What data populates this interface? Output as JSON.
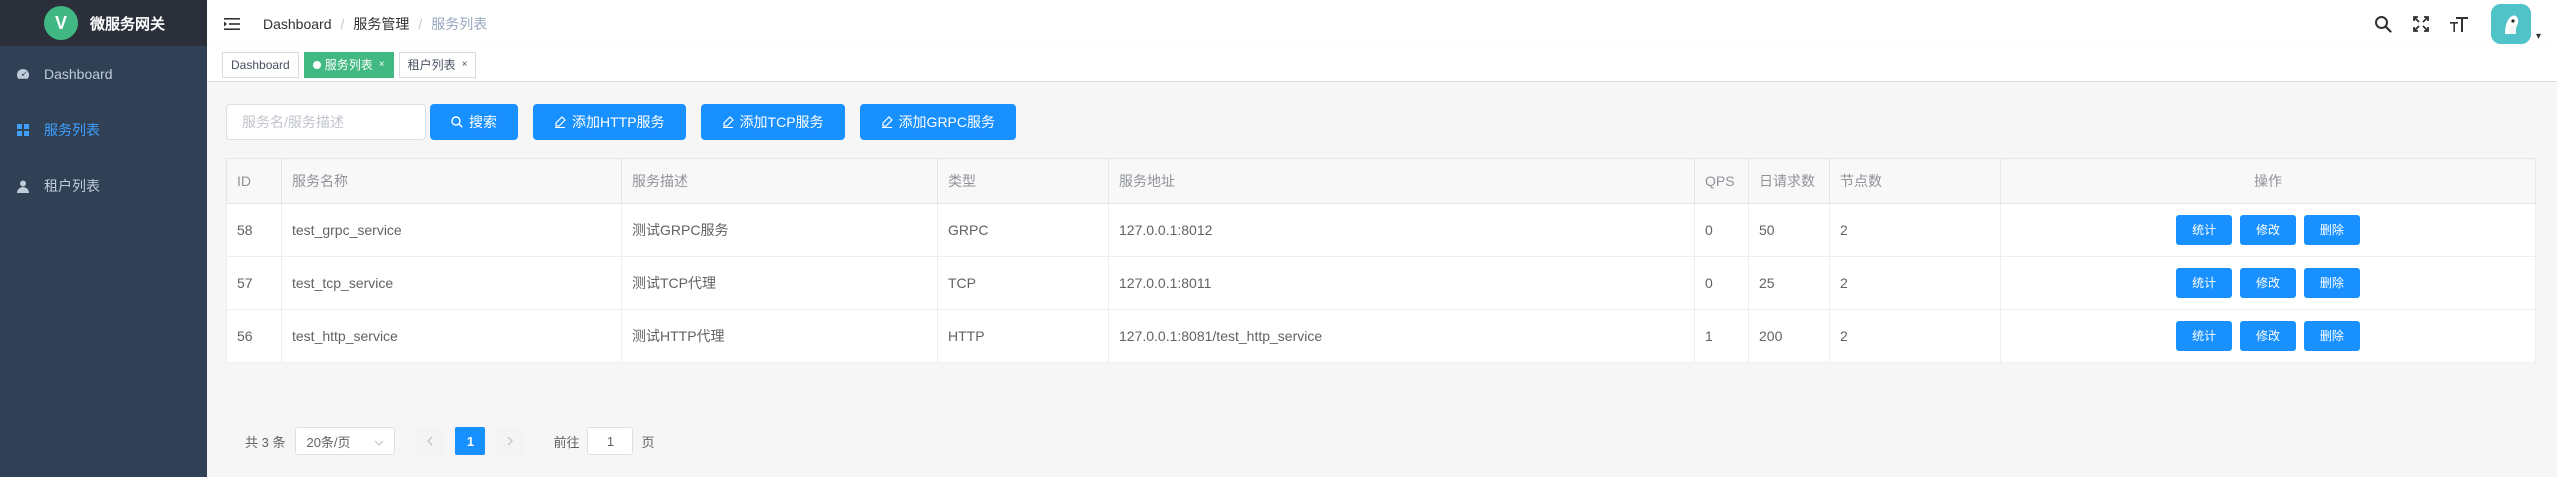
{
  "sidebar": {
    "logo_letter": "V",
    "title": "微服务网关",
    "items": [
      {
        "label": "Dashboard",
        "icon": "dashboard-icon",
        "active": false
      },
      {
        "label": "服务列表",
        "icon": "grid-icon",
        "active": true
      },
      {
        "label": "租户列表",
        "icon": "user-icon",
        "active": false
      }
    ]
  },
  "breadcrumb": {
    "items": [
      "Dashboard",
      "服务管理",
      "服务列表"
    ],
    "separator": "/"
  },
  "navbar": {
    "icons": [
      "search-icon",
      "fullscreen-icon",
      "font-size-icon"
    ],
    "caret": "▾"
  },
  "tags": {
    "items": [
      {
        "label": "Dashboard",
        "active": false
      },
      {
        "label": "服务列表",
        "active": true,
        "close": "×"
      },
      {
        "label": "租户列表",
        "active": false,
        "close": "×"
      }
    ]
  },
  "filter": {
    "search_placeholder": "服务名/服务描述",
    "search_button": "搜索",
    "add_http": "添加HTTP服务",
    "add_tcp": "添加TCP服务",
    "add_grpc": "添加GRPC服务"
  },
  "table": {
    "columns": [
      "ID",
      "服务名称",
      "服务描述",
      "类型",
      "服务地址",
      "QPS",
      "日请求数",
      "节点数",
      "操作"
    ],
    "rows": [
      {
        "id": "58",
        "name": "test_grpc_service",
        "desc": "测试GRPC服务",
        "type": "GRPC",
        "addr": "127.0.0.1:8012",
        "qps": "0",
        "daily": "50",
        "nodes": "2"
      },
      {
        "id": "57",
        "name": "test_tcp_service",
        "desc": "测试TCP代理",
        "type": "TCP",
        "addr": "127.0.0.1:8011",
        "qps": "0",
        "daily": "25",
        "nodes": "2"
      },
      {
        "id": "56",
        "name": "test_http_service",
        "desc": "测试HTTP代理",
        "type": "HTTP",
        "addr": "127.0.0.1:8081/test_http_service",
        "qps": "1",
        "daily": "200",
        "nodes": "2"
      }
    ],
    "actions": {
      "stat": "统计",
      "edit": "修改",
      "delete": "删除"
    }
  },
  "pagination": {
    "total": "共 3 条",
    "page_size": "20条/页",
    "current_page": "1",
    "jump_prefix": "前往",
    "jump_value": "1",
    "jump_suffix": "页"
  },
  "colors": {
    "sidebar_bg": "#304156",
    "primary": "#1890ff",
    "tag_active": "#42b983"
  }
}
